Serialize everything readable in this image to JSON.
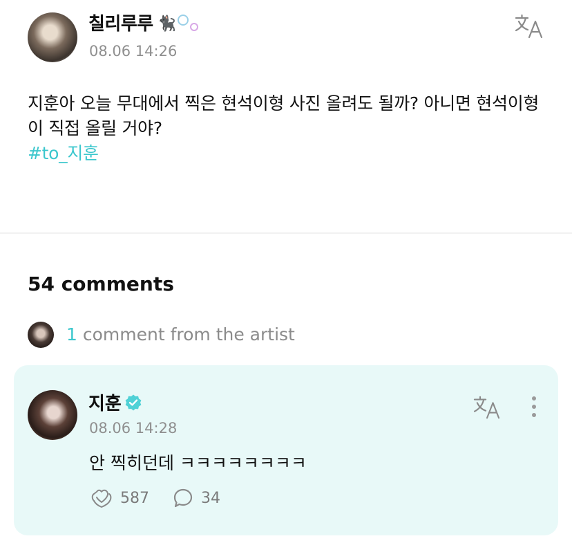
{
  "post": {
    "author": "칠리루루",
    "author_emoji": "🐈‍⬛",
    "date": "08.06 14:26",
    "text": "지훈아 오늘 무대에서 찍은 현석이형 사진 올려도 될까? 아니면 현석이형이 직접 올릴 거야?",
    "hashtag": "#to_지훈",
    "icons": {
      "translate": "translate-icon"
    }
  },
  "comments": {
    "count_label": "54 comments",
    "artist_count": "1",
    "artist_label": "comment from the artist"
  },
  "artist_comment": {
    "name": "지훈",
    "date": "08.06 14:28",
    "text": "안 찍히던데 ㅋㅋㅋㅋㅋㅋㅋㅋ",
    "likes": "587",
    "replies": "34",
    "icons": {
      "verified": "verified-badge-icon",
      "translate": "translate-icon",
      "more": "more-vertical-icon",
      "like": "heart-hands-icon",
      "reply": "speech-bubble-icon"
    }
  },
  "colors": {
    "accent": "#3cc7cd",
    "card_bg": "#e8f9f8",
    "muted": "#8f8f8f"
  }
}
